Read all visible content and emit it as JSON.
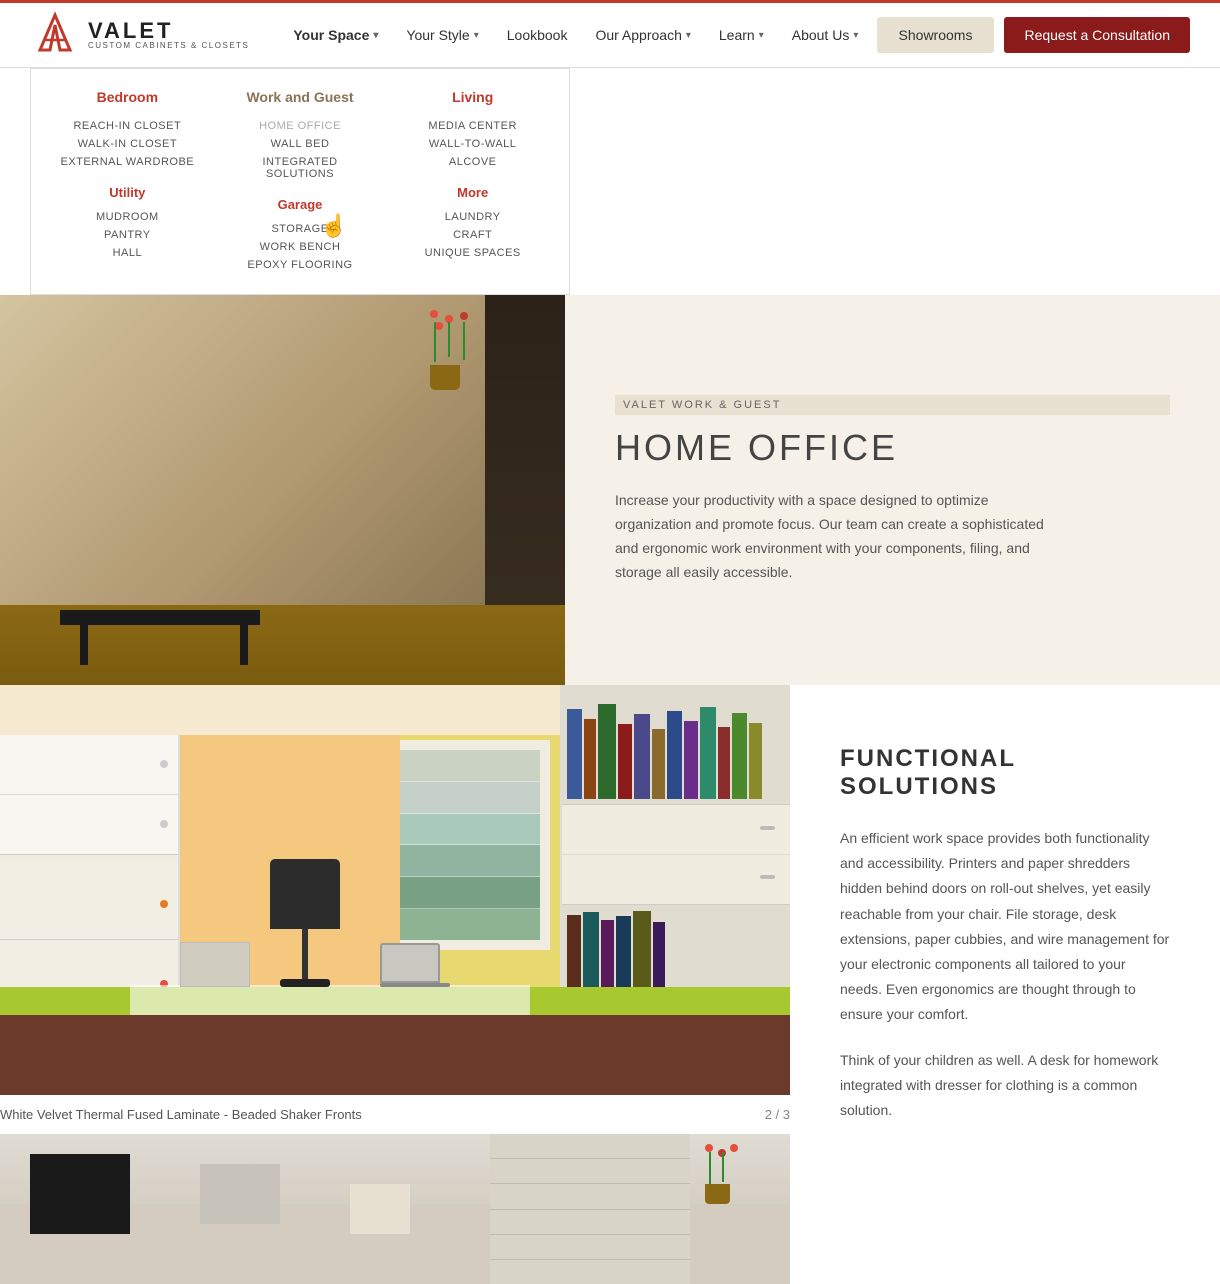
{
  "brand": {
    "name": "VALET",
    "tagline": "CUSTOM CABINETS & CLOSETS",
    "logo_v": "V"
  },
  "nav": {
    "items": [
      {
        "label": "Your Space",
        "has_dropdown": true,
        "active": true
      },
      {
        "label": "Your Style",
        "has_dropdown": true
      },
      {
        "label": "Lookbook",
        "has_dropdown": false
      },
      {
        "label": "Our Approach",
        "has_dropdown": true
      },
      {
        "label": "Learn",
        "has_dropdown": true
      },
      {
        "label": "About Us",
        "has_dropdown": true
      }
    ],
    "btn_showrooms": "Showrooms",
    "btn_consultation": "Request a Consultation"
  },
  "dropdown": {
    "columns": [
      {
        "header": "Bedroom",
        "header_color": "red",
        "items": [
          "REACH-IN CLOSET",
          "WALK-IN CLOSET",
          "EXTERNAL WARDROBE"
        ],
        "sub_sections": [
          {
            "header": "Utility",
            "items": [
              "MUDROOM",
              "PANTRY",
              "HALL"
            ]
          }
        ]
      },
      {
        "header": "Work and Guest",
        "header_color": "tan",
        "items": [
          "HOME OFFICE",
          "WALL BED",
          "INTEGRATED SOLUTIONS"
        ],
        "sub_sections": [
          {
            "header": "Garage",
            "items": [
              "STORAGE",
              "WORK BENCH",
              "EPOXY FLOORING"
            ]
          }
        ]
      },
      {
        "header": "Living",
        "header_color": "red",
        "items": [
          "MEDIA CENTER",
          "WALL-TO-WALL",
          "ALCOVE"
        ],
        "sub_sections": [
          {
            "header": "More",
            "items": [
              "LAUNDRY",
              "CRAFT",
              "UNIQUE SPACES"
            ]
          }
        ]
      }
    ]
  },
  "hero": {
    "label": "VALET WORK & GUEST",
    "title": "HOME OFFICE",
    "description": "Increase your productivity with a space designed to optimize organization and promote focus. Our team can create a sophisticated and ergonomic work environment with your components, filing, and storage all easily accessible."
  },
  "content": {
    "section_title": "FUNCTIONAL SOLUTIONS",
    "paragraph1": "An efficient work space provides both functionality and accessibility.  Printers and paper shredders hidden behind doors on roll-out shelves, yet easily reachable from your chair.  File storage, desk extensions, paper cubbies, and wire management for your electronic components all tailored to your needs.  Even ergonomics are thought through to ensure your comfort.",
    "paragraph2": "Think of your children as well.  A desk for homework integrated with dresser for clothing is a common solution.",
    "caption": "White Velvet Thermal Fused Laminate - Beaded Shaker Fronts",
    "counter": "2 / 3"
  }
}
